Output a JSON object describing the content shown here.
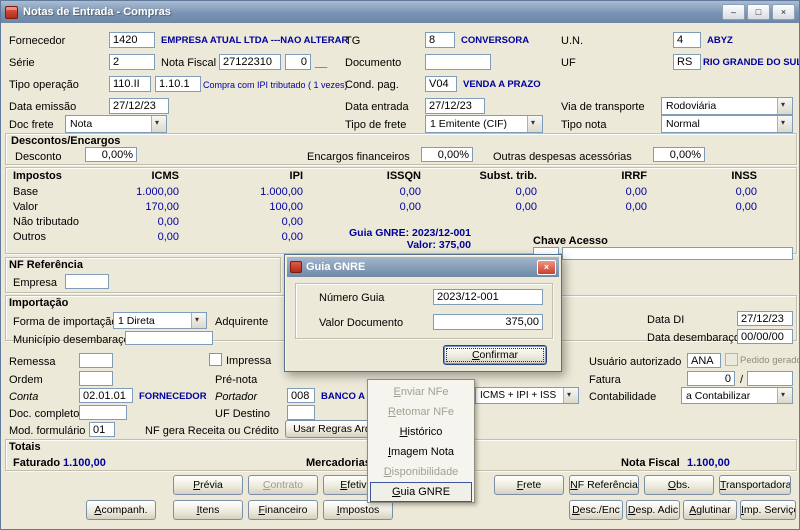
{
  "window": {
    "title": "Notas de Entrada - Compras",
    "minimize": "–",
    "maximize": "□",
    "close": "×"
  },
  "form": {
    "fornecedor": {
      "label": "Fornecedor",
      "code": "1420",
      "desc": "EMPRESA ATUAL LTDA ---NAO ALTERAR"
    },
    "tg": {
      "label": "TG",
      "code": "8",
      "desc": "CONVERSORA"
    },
    "un": {
      "label": "U.N.",
      "code": "4",
      "desc": "ABYZ"
    },
    "serie": {
      "label": "Série",
      "value": "2"
    },
    "nota_fiscal": {
      "label": "Nota Fiscal",
      "numero": "27122310",
      "aux": "0",
      "mask": "__"
    },
    "documento": {
      "label": "Documento",
      "value": ""
    },
    "uf": {
      "label": "UF",
      "code": "RS",
      "desc": "RIO GRANDE DO SUL"
    },
    "tipo_operacao": {
      "label": "Tipo operação",
      "code1": "110.II",
      "code2": "1.10.1",
      "desc": "Compra com IPI tributado ( 1 vezes)"
    },
    "cond_pag": {
      "label": "Cond. pag.",
      "code": "V04",
      "desc": "VENDA A PRAZO"
    },
    "data_emissao": {
      "label": "Data emissão",
      "value": "27/12/23"
    },
    "data_entrada": {
      "label": "Data entrada",
      "value": "27/12/23"
    },
    "via_transporte": {
      "label": "Via de transporte",
      "value": "Rodoviária"
    },
    "doc_frete": {
      "label": "Doc frete",
      "value": "Nota"
    },
    "tipo_frete": {
      "label": "Tipo de frete",
      "value": "1 Emitente (CIF)"
    },
    "tipo_nota": {
      "label": "Tipo nota",
      "value": "Normal"
    }
  },
  "descontos": {
    "title": "Descontos/Encargos",
    "desconto_label": "Desconto",
    "desconto": "0,00%",
    "encargos_label": "Encargos financeiros",
    "encargos": "0,00%",
    "outras_label": "Outras despesas acessórias",
    "outras": "0,00%"
  },
  "impostos": {
    "title": "Impostos",
    "columns": [
      "ICMS",
      "IPI",
      "ISSQN",
      "Subst. trib.",
      "IRRF",
      "INSS"
    ],
    "rows": [
      {
        "label": "Base",
        "values": [
          "1.000,00",
          "1.000,00",
          "0,00",
          "0,00",
          "0,00",
          "0,00"
        ]
      },
      {
        "label": "Valor",
        "values": [
          "170,00",
          "100,00",
          "0,00",
          "0,00",
          "0,00",
          "0,00"
        ]
      },
      {
        "label": "Não tributado",
        "values": [
          "0,00",
          "0,00",
          "",
          "",
          "",
          ""
        ]
      },
      {
        "label": "Outros",
        "values": [
          "0,00",
          "0,00",
          "",
          "",
          "",
          ""
        ]
      }
    ],
    "guia_note": "Guia GNRE: 2023/12-001",
    "valor_note": "Valor: 375,00",
    "chave_acesso_label": "Chave Acesso",
    "chave1": "",
    "chave2": ""
  },
  "nf_referencia": {
    "title": "NF Referência",
    "empresa_label": "Empresa",
    "empresa": ""
  },
  "importacao": {
    "title": "Importação",
    "forma_label": "Forma de importação",
    "forma": "1 Direta",
    "adquirente_label": "Adquirente",
    "municipio_label": "Município desembaraço",
    "municipio": "",
    "data_di_label": "Data DI",
    "data_di": "27/12/23",
    "data_desembaraco_label": "Data desembaraço",
    "data_desembaraco": "00/00/00"
  },
  "detalhes": {
    "remessa_label": "Remessa",
    "remessa": "",
    "impressa_label": "Impressa",
    "usuario_label": "Usuário autorizado",
    "usuario": "ANA",
    "pedido_gerado_label": "Pedido gerado",
    "ordem_label": "Ordem",
    "ordem": "",
    "pre_nota_label": "Pré-nota",
    "fatura_label": "Fatura",
    "fatura": "0",
    "fatura_sep": "/",
    "fatura2": "",
    "conta_label": "Conta",
    "conta": "02.01.01",
    "conta_desc": "FORNECEDOR",
    "portador_label": "Portador",
    "portador": "008",
    "portador_desc": "BANCO A",
    "tributos_combo": "ICMS + IPI + ISS",
    "contabilidade_label": "Contabilidade",
    "contabilidade": "a Contabilizar",
    "doc_completo_label": "Doc. completo",
    "doc_completo": "",
    "uf_destino_label": "UF Destino",
    "uf_destino": "",
    "mod_formulario_label": "Mod. formulário",
    "mod_formulario": "01",
    "nf_gera_label": "NF gera Receita ou Crédito",
    "usar_regras_button": "Usar Regras Arquivadas"
  },
  "dialog": {
    "title": "Guia GNRE",
    "close": "×",
    "numero_label": "Número Guia",
    "numero": "2023/12-001",
    "valor_label": "Valor Documento",
    "valor": "375,00",
    "confirmar": "Confirmar"
  },
  "menu": {
    "items": [
      {
        "label": "Enviar NFe",
        "enabled": false
      },
      {
        "label": "Retomar NFe",
        "enabled": false
      },
      {
        "label": "Histórico",
        "enabled": true
      },
      {
        "label": "Imagem Nota",
        "enabled": true
      },
      {
        "label": "Disponibilidade",
        "enabled": false
      },
      {
        "label": "Guia GNRE",
        "enabled": true,
        "selected": true
      }
    ]
  },
  "totais": {
    "title": "Totais",
    "faturado_label": "Faturado",
    "faturado": "1.100,00",
    "mercadorias_label": "Mercadorias",
    "nota_fiscal_label": "Nota Fiscal",
    "nota_fiscal": "1.100,00"
  },
  "actions": {
    "row1": [
      "Prévia",
      "Contrato",
      "Efetivar",
      "Frete",
      "NF Referência",
      "Obs.",
      "Transportadora"
    ],
    "row2": [
      "Acompanh.",
      "Itens",
      "Financeiro",
      "Impostos",
      "Desc./Enc",
      "Desp. Adic",
      "Aglutinar",
      "Imp. Serviço"
    ]
  },
  "colors": {
    "accent_blue": "#00009c",
    "titlebar": "#7a93b2",
    "background": "#ece9d8",
    "field_border": "#7f9db9"
  }
}
